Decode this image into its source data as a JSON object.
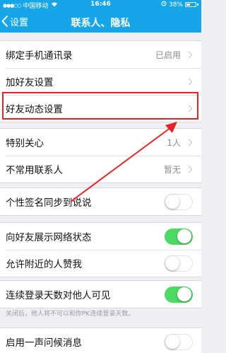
{
  "status_bar": {
    "carrier": "中国移动",
    "time": "16:46",
    "battery": "38%",
    "icons": [
      "signal-icon",
      "wifi-icon",
      "alarm-icon",
      "battery-icon"
    ]
  },
  "nav": {
    "back_label": "设置",
    "title": "联系人、隐私"
  },
  "groups": [
    {
      "rows": [
        {
          "label": "绑定手机通讯录",
          "value": "已启用"
        },
        {
          "label": "加好友设置",
          "value": ""
        },
        {
          "label": "好友动态设置",
          "value": ""
        }
      ]
    },
    {
      "rows": [
        {
          "label": "特别关心",
          "value": "1人"
        },
        {
          "label": "不常用联系人",
          "value": "暂无"
        }
      ]
    },
    {
      "rows": [
        {
          "label": "个性签名同步到说说",
          "on": false
        }
      ]
    },
    {
      "rows": [
        {
          "label": "向好友展示网络状态",
          "on": true
        },
        {
          "label": "允许附近的人赞我",
          "on": false
        }
      ]
    },
    {
      "rows": [
        {
          "label": "连续登录天数对他人可见",
          "on": true
        }
      ],
      "note": "关闭后，他人将不可以和你PK连续登录天数。"
    },
    {
      "rows": [
        {
          "label": "启用一声问候消息",
          "on": false
        }
      ]
    }
  ],
  "colors": {
    "nav_bg": "#16a6e8",
    "toggle_on": "#4cd964",
    "annotation": "#e0262c"
  }
}
